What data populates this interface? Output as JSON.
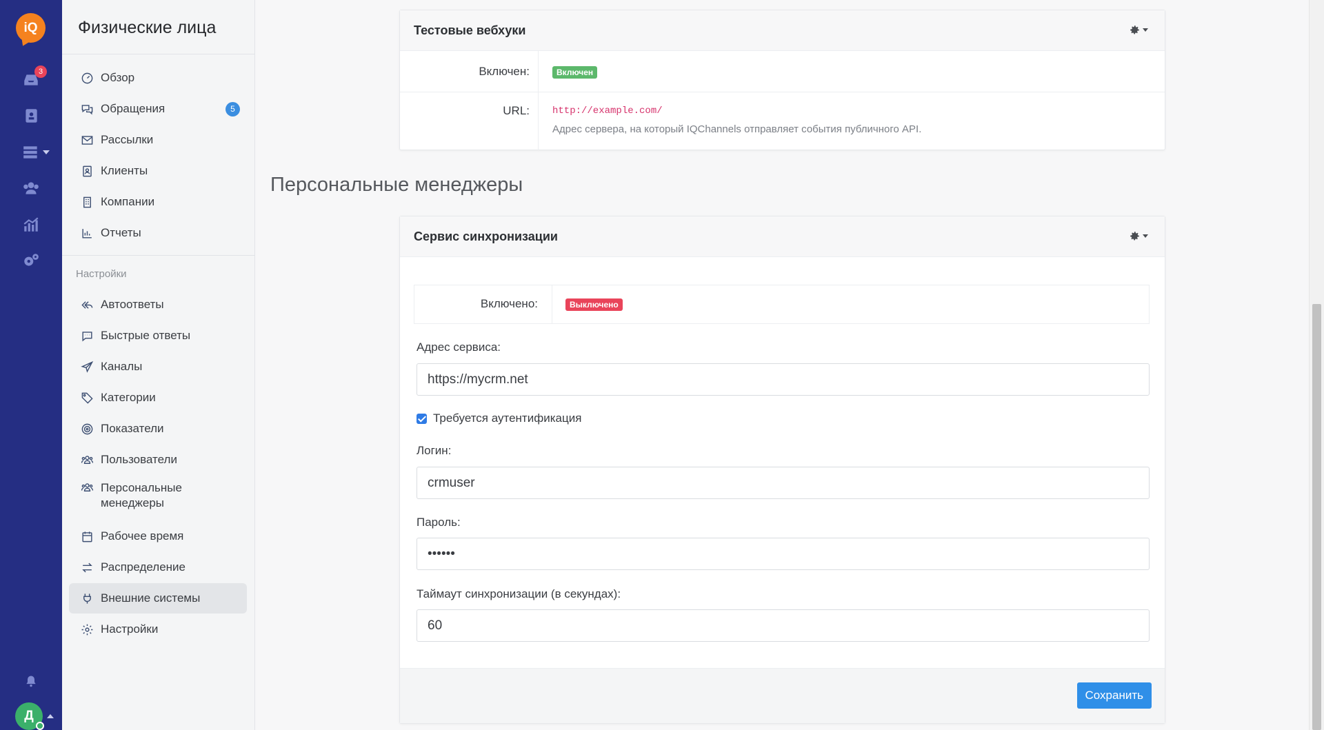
{
  "rail": {
    "logo": "iQ",
    "inbox_badge": "3",
    "avatar_letter": "Д"
  },
  "sidebar": {
    "title": "Физические лица",
    "items": [
      {
        "label": "Обзор"
      },
      {
        "label": "Обращения",
        "badge": "5"
      },
      {
        "label": "Рассылки"
      },
      {
        "label": "Клиенты"
      },
      {
        "label": "Компании"
      },
      {
        "label": "Отчеты"
      }
    ],
    "settings_section": "Настройки",
    "settings_items": [
      {
        "label": "Автоответы"
      },
      {
        "label": "Быстрые ответы"
      },
      {
        "label": "Каналы"
      },
      {
        "label": "Категории"
      },
      {
        "label": "Показатели"
      },
      {
        "label": "Пользователи"
      },
      {
        "label": "Персональные менеджеры"
      },
      {
        "label": "Рабочее время"
      },
      {
        "label": "Распределение"
      },
      {
        "label": "Внешние системы",
        "active": true
      },
      {
        "label": "Настройки"
      }
    ]
  },
  "webhooks_card": {
    "title": "Тестовые вебхуки",
    "enabled_label": "Включен:",
    "enabled_value": "Включен",
    "url_label": "URL:",
    "url_value": "http://example.com/",
    "url_help": "Адрес сервера, на который IQChannels отправляет события публичного API."
  },
  "section_title": "Персональные менеджеры",
  "sync_card": {
    "title": "Сервис синхронизации",
    "enabled_label": "Включено:",
    "enabled_value": "Выключено",
    "address_label": "Адрес сервиса:",
    "address_value": "https://mycrm.net",
    "auth_checkbox_label": "Требуется аутентификация",
    "auth_checked": true,
    "login_label": "Логин:",
    "login_value": "crmuser",
    "password_label": "Пароль:",
    "password_value": "••••••",
    "timeout_label": "Таймаут синхронизации (в секундах):",
    "timeout_value": "60",
    "save_button": "Сохранить"
  },
  "colors": {
    "rail_bg": "#252e83",
    "brand_orange": "#f5821f",
    "enabled_green": "#5cb86b",
    "disabled_red": "#e9445a",
    "primary_blue": "#2f8fe8"
  }
}
